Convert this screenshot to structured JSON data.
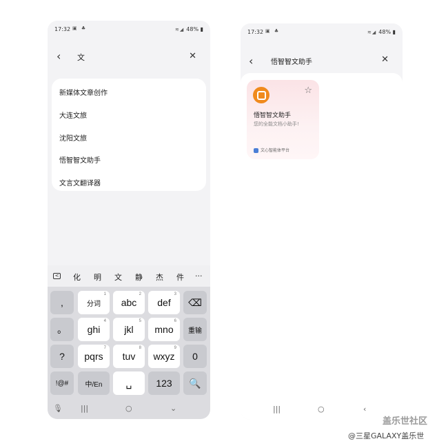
{
  "left": {
    "status": {
      "time": "17:32",
      "battery": "48%"
    },
    "search": {
      "query": "文"
    },
    "suggestions": [
      "新媒体文章创作",
      "大连文旅",
      "沈阳文旅",
      "悟智智文助手",
      "文言文翻译器"
    ],
    "candidates": [
      "化",
      "明",
      "文",
      "静",
      "杰",
      "件",
      "···"
    ],
    "keyboard": {
      "row1": [
        {
          "label": ",",
          "sub": ""
        },
        {
          "label": "分词",
          "sub": "1"
        },
        {
          "label": "abc",
          "sub": "2"
        },
        {
          "label": "def",
          "sub": "3"
        },
        {
          "label": "⌫",
          "sub": ""
        }
      ],
      "row2": [
        {
          "label": "。",
          "sub": ""
        },
        {
          "label": "ghi",
          "sub": "4"
        },
        {
          "label": "jkl",
          "sub": "5"
        },
        {
          "label": "mno",
          "sub": "6"
        },
        {
          "label": "重输",
          "sub": ""
        }
      ],
      "row3": [
        {
          "label": "?",
          "sub": ""
        },
        {
          "label": "pqrs",
          "sub": "7"
        },
        {
          "label": "tuv",
          "sub": "8"
        },
        {
          "label": "wxyz",
          "sub": "9"
        },
        {
          "label": "0",
          "sub": ""
        }
      ],
      "row4": [
        {
          "label": "!@#",
          "sub": ""
        },
        {
          "label": "中/En",
          "sub": ""
        },
        {
          "label": "␣",
          "sub": ""
        },
        {
          "label": "123",
          "sub": ""
        },
        {
          "label": "🔍",
          "sub": ""
        }
      ]
    }
  },
  "right": {
    "status": {
      "time": "17:32",
      "battery": "48%"
    },
    "header": {
      "title": "悟智智文助手"
    },
    "agent": {
      "name": "悟智智文助手",
      "desc": "您的全能文档小助手!",
      "platform": "文心智能体平台",
      "logo_color": "#f08a1c"
    }
  },
  "watermark": {
    "line1": "盖乐世社区",
    "line2": "@三星GALAXY盖乐世"
  }
}
